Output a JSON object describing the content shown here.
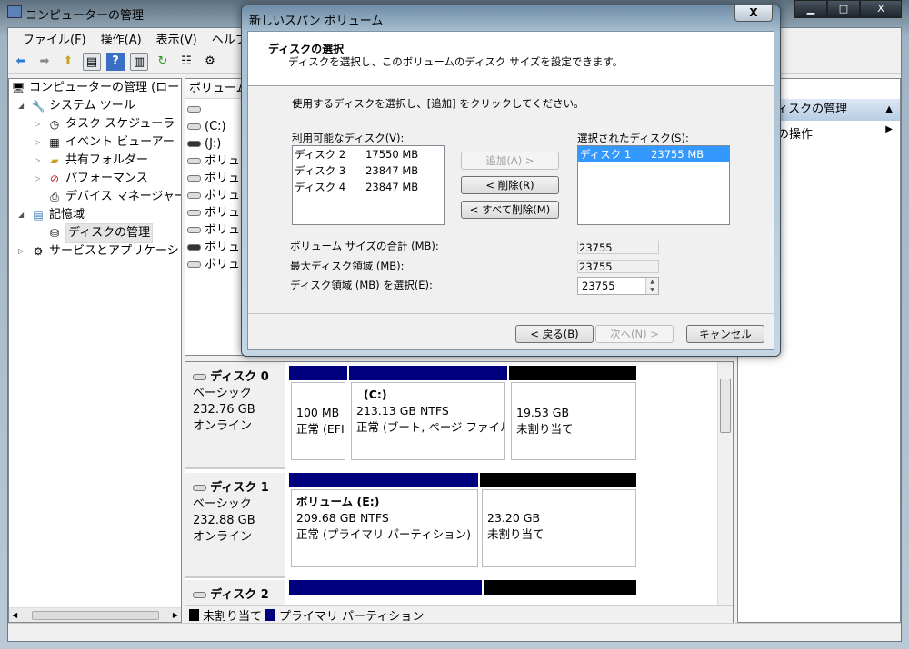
{
  "window": {
    "title": "コンピューターの管理",
    "min": "▁",
    "max": "□",
    "close": "X"
  },
  "menu": [
    "ファイル(F)",
    "操作(A)",
    "表示(V)",
    "ヘルプ(H)"
  ],
  "tree": {
    "root": "コンピューターの管理 (ローカル)",
    "items": [
      {
        "label": "システム ツール",
        "arrow": "◢",
        "icon": "🔧"
      },
      {
        "label": "タスク スケジューラ",
        "arrow": "▷",
        "icon": "🕒"
      },
      {
        "label": "イベント ビューアー",
        "arrow": "▷",
        "icon": "📒"
      },
      {
        "label": "共有フォルダー",
        "arrow": "▷",
        "icon": "📁"
      },
      {
        "label": "パフォーマンス",
        "arrow": "▷",
        "icon": "⊘"
      },
      {
        "label": "デバイス マネージャー",
        "arrow": "",
        "icon": "🖨"
      },
      {
        "label": "記憶域",
        "arrow": "◢",
        "icon": "🗄"
      },
      {
        "label": "ディスクの管理",
        "arrow": "",
        "icon": "💽"
      },
      {
        "label": "サービスとアプリケーション",
        "arrow": "▷",
        "icon": "⚙"
      }
    ]
  },
  "volumes": {
    "header": "ボリューム",
    "rows": [
      "",
      "(C:)",
      "(J:)",
      "ボリューム",
      "ボリューム",
      "ボリューム",
      "ボリューム",
      "ボリューム",
      "ボリューム",
      "ボリューム"
    ]
  },
  "disks": [
    {
      "name": "ディスク 0",
      "type": "ベーシック",
      "size": "232.76 GB",
      "status": "オンライン",
      "parts": [
        {
          "title": "",
          "size": "100 MB",
          "status": "正常 (EFI"
        },
        {
          "title": "(C:)",
          "size": "213.13 GB NTFS",
          "status": "正常 (ブート, ページ ファイル"
        },
        {
          "title": "",
          "size": "19.53 GB",
          "status": "未割り当て"
        }
      ]
    },
    {
      "name": "ディスク 1",
      "type": "ベーシック",
      "size": "232.88 GB",
      "status": "オンライン",
      "parts": [
        {
          "title": "ボリューム  (E:)",
          "size": "209.68 GB NTFS",
          "status": "正常 (プライマリ パーティション)"
        },
        {
          "title": "",
          "size": "23.20 GB",
          "status": "未割り当て"
        }
      ]
    },
    {
      "name": "ディスク 2"
    }
  ],
  "legend": {
    "unallocated": "未割り当て",
    "primary": "プライマリ パーティション"
  },
  "colors": {
    "primary": "#00007f",
    "unallocated": "#000000",
    "selection": "#3399ff"
  },
  "actions": {
    "header": "ディスクの管理",
    "item": "他の操作"
  },
  "dialog": {
    "title": "新しいスパン ボリューム",
    "close": "X",
    "heading": "ディスクの選択",
    "subheading": "ディスクを選択し、このボリュームのディスク サイズを設定できます。",
    "instruction": "使用するディスクを選択し、[追加] をクリックしてください。",
    "available_label": "利用可能なディスク(V):",
    "available": [
      "ディスク 2      17550 MB",
      "ディスク 3      23847 MB",
      "ディスク 4      23847 MB"
    ],
    "selected_label": "選択されたディスク(S):",
    "selected": [
      "ディスク 1      23755 MB"
    ],
    "add": "追加(A) >",
    "remove": "< 削除(R)",
    "remove_all": "< すべて削除(M)",
    "total_label": "ボリューム サイズの合計 (MB):",
    "total": "23755",
    "max_label": "最大ディスク領域 (MB):",
    "max": "23755",
    "select_label": "ディスク領域 (MB) を選択(E):",
    "select": "23755",
    "back": "< 戻る(B)",
    "next": "次へ(N) >",
    "cancel": "キャンセル"
  }
}
